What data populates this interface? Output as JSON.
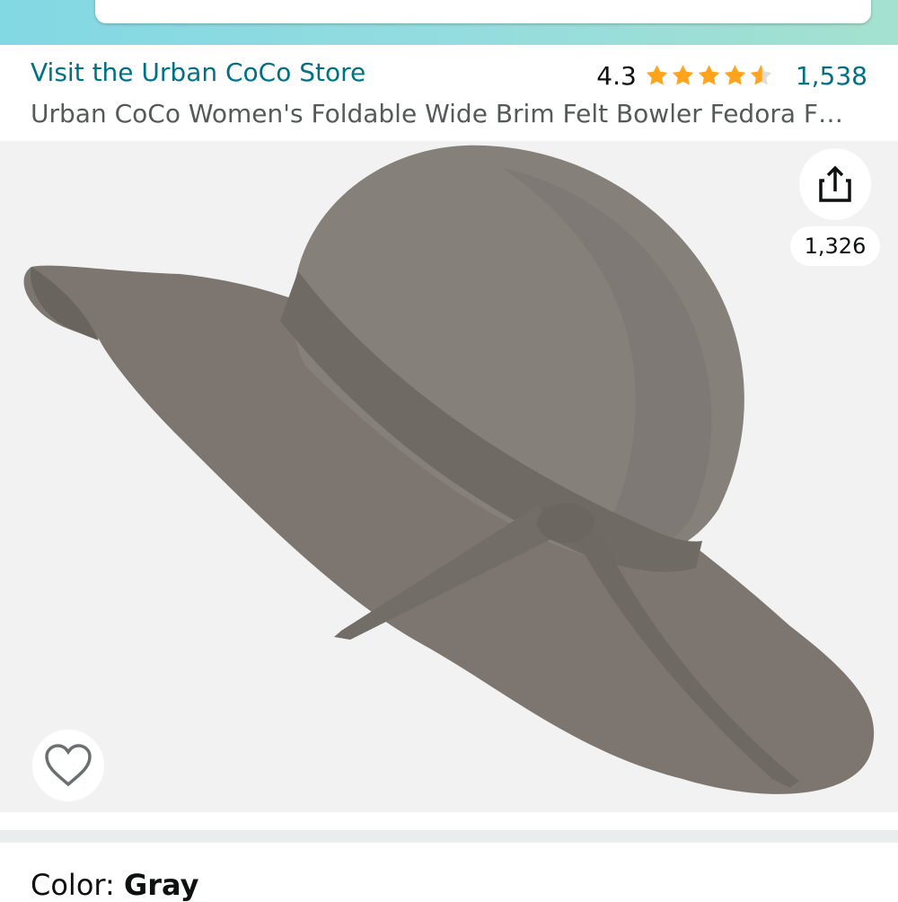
{
  "store": {
    "link": "Visit the Urban CoCo Store"
  },
  "rating": {
    "value": "4.3",
    "stars": 4.3,
    "count": "1,538"
  },
  "product": {
    "title": "Urban CoCo Women's Foldable Wide Brim Felt Bowler Fedora F…"
  },
  "image": {
    "share_count": "1,326",
    "share_icon": "share-icon",
    "favorite_icon": "heart-icon"
  },
  "selection": {
    "color_label": "Color:",
    "color_value": "Gray"
  },
  "colors": {
    "link": "#007185",
    "star": "#FFA41C",
    "header": "#93dcdf",
    "hat": "#7d7670"
  }
}
